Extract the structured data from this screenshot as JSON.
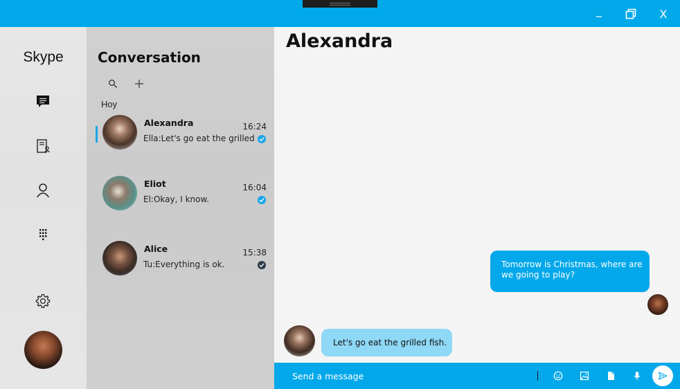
{
  "window": {
    "controls": {
      "minimize": "_",
      "close": "X"
    }
  },
  "nav": {
    "app_name": "Skype",
    "items": [
      {
        "icon": "chat-icon"
      },
      {
        "icon": "contacts-book-icon"
      },
      {
        "icon": "person-icon"
      },
      {
        "icon": "dialpad-icon"
      },
      {
        "icon": "gear-icon"
      }
    ]
  },
  "conversations": {
    "title": "Conversation",
    "section_label": "Hoy",
    "items": [
      {
        "name": "Alexandra",
        "preview": "Ella:Let's go eat the grilled",
        "time": "16:24",
        "status": "read-blue",
        "selected": true
      },
      {
        "name": "Eliot",
        "preview": "El:Okay, I know.",
        "time": "16:04",
        "status": "read-blue",
        "selected": false
      },
      {
        "name": "Alice",
        "preview": "Tu:Everything is ok.",
        "time": "15:38",
        "status": "read-dark",
        "selected": false
      }
    ]
  },
  "chat": {
    "title": "Alexandra",
    "messages": [
      {
        "direction": "outgoing",
        "text": "Tomorrow is Christmas, where are we going to play?"
      },
      {
        "direction": "incoming",
        "text": "Let's go eat the grilled fish."
      }
    ]
  },
  "composer": {
    "placeholder": "Send a message",
    "icons": [
      "emoji-icon",
      "image-icon",
      "file-icon",
      "microphone-icon",
      "send-icon"
    ]
  },
  "colors": {
    "accent": "#02a9ea",
    "outgoing_bubble": "#03a8ea",
    "incoming_bubble": "#8fd8f6",
    "tick_blue": "#1aa6e8",
    "tick_dark": "#2e3d49"
  }
}
